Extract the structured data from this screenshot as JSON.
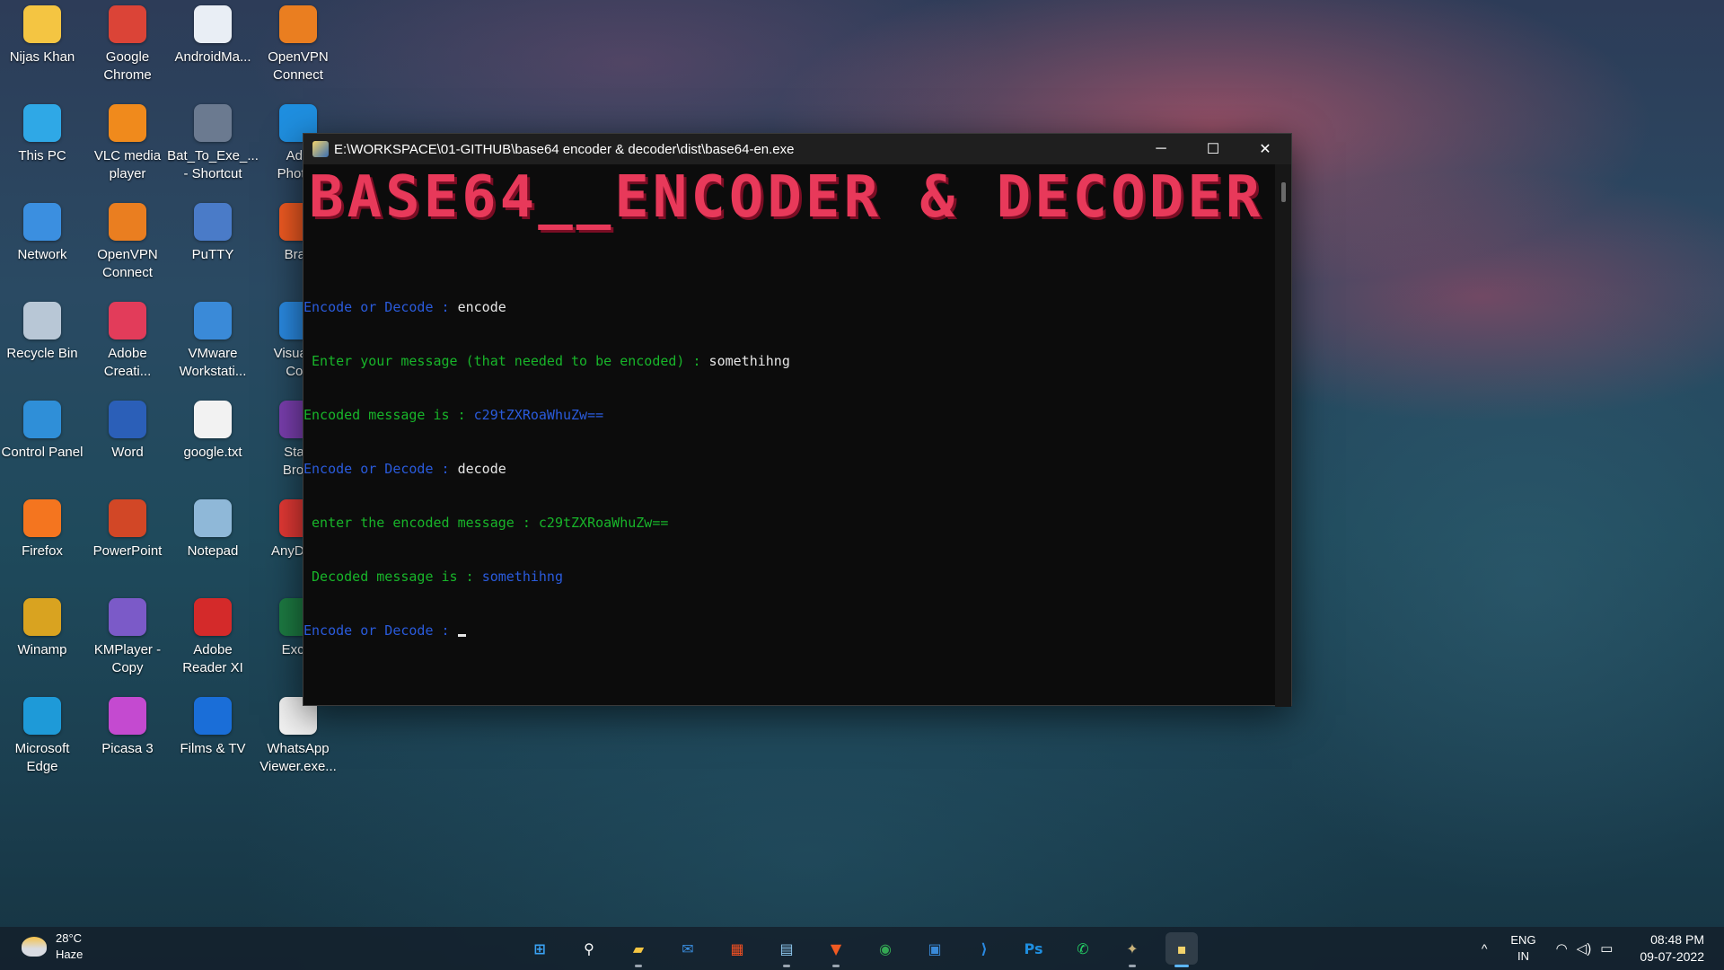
{
  "desktop": {
    "icons": [
      {
        "label": "Nijas Khan",
        "icon": "folder-icon",
        "color": "#f4c542"
      },
      {
        "label": "Google\nChrome",
        "icon": "chrome-icon",
        "color": "#db4437"
      },
      {
        "label": "AndroidMa...",
        "icon": "document-icon",
        "color": "#e9eef5"
      },
      {
        "label": "OpenVPN\nConnect",
        "icon": "openvpn-icon",
        "color": "#ea7e20"
      },
      {
        "label": "This PC",
        "icon": "monitor-icon",
        "color": "#2fa8e6"
      },
      {
        "label": "VLC media\nplayer",
        "icon": "vlc-icon",
        "color": "#f08a1c"
      },
      {
        "label": "Bat_To_Exe_...\n- Shortcut",
        "icon": "gear-icon",
        "color": "#6b7a90"
      },
      {
        "label": "Ado\nPhotos",
        "icon": "photoshop-icon",
        "color": "#1f8fe0"
      },
      {
        "label": "Network",
        "icon": "network-icon",
        "color": "#3b8fe0"
      },
      {
        "label": "OpenVPN\nConnect",
        "icon": "openvpn-icon",
        "color": "#ea7e20"
      },
      {
        "label": "PuTTY",
        "icon": "putty-icon",
        "color": "#4a7bc8"
      },
      {
        "label": "Brav",
        "icon": "brave-icon",
        "color": "#f05a22"
      },
      {
        "label": "Recycle Bin",
        "icon": "recycle-bin-icon",
        "color": "#b8c7d6"
      },
      {
        "label": "Adobe\nCreati...",
        "icon": "creative-cloud-icon",
        "color": "#e23c5a"
      },
      {
        "label": "VMware\nWorkstati...",
        "icon": "vmware-icon",
        "color": "#3a8ad8"
      },
      {
        "label": "Visual S\nCod",
        "icon": "vscode-icon",
        "color": "#2a8ae2"
      },
      {
        "label": "Control Panel",
        "icon": "control-panel-icon",
        "color": "#2f8fd8"
      },
      {
        "label": "Word",
        "icon": "word-icon",
        "color": "#2b5fb8"
      },
      {
        "label": "google.txt",
        "icon": "text-file-icon",
        "color": "#f2f2f2"
      },
      {
        "label": "Start\nBrow",
        "icon": "tor-icon",
        "color": "#7b3fb0"
      },
      {
        "label": "Firefox",
        "icon": "firefox-icon",
        "color": "#f4751f"
      },
      {
        "label": "PowerPoint",
        "icon": "powerpoint-icon",
        "color": "#d24726"
      },
      {
        "label": "Notepad",
        "icon": "notepad-icon",
        "color": "#8fb8d8"
      },
      {
        "label": "AnyDesk",
        "icon": "anydesk-icon",
        "color": "#e53935"
      },
      {
        "label": "Winamp",
        "icon": "winamp-icon",
        "color": "#d9a320"
      },
      {
        "label": "KMPlayer -\nCopy",
        "icon": "kmplayer-icon",
        "color": "#7b5ac8"
      },
      {
        "label": "Adobe\nReader XI",
        "icon": "pdf-icon",
        "color": "#d42a2a"
      },
      {
        "label": "Excel",
        "icon": "excel-icon",
        "color": "#1d7c43"
      },
      {
        "label": "Microsoft\nEdge",
        "icon": "edge-icon",
        "color": "#1e9ad8"
      },
      {
        "label": "Picasa 3",
        "icon": "picasa-icon",
        "color": "#c44ad0"
      },
      {
        "label": "Films & TV",
        "icon": "films-tv-icon",
        "color": "#1a6ed8"
      },
      {
        "label": "WhatsApp\nViewer.exe...",
        "icon": "file-icon",
        "color": "#f2f2f2"
      }
    ]
  },
  "console": {
    "title": "E:\\WORKSPACE\\01-GITHUB\\base64 encoder & decoder\\dist\\base64-en.exe",
    "minimize": "─",
    "maximize": "☐",
    "close": "✕",
    "banner": "BASE64__ENCODER & DECODER",
    "lines": [
      {
        "prompt": "Encode or Decode : ",
        "value": "encode"
      },
      {
        "prompt": " Enter your message (that needed to be encoded) : ",
        "value": "somethihng"
      },
      {
        "prompt": "Encoded message is : ",
        "value": "c29tZXRoaWhuZw=="
      },
      {
        "prompt": "Encode or Decode : ",
        "value": "decode"
      },
      {
        "prompt": " enter the encoded message : ",
        "value": "c29tZXRoaWhuZw=="
      },
      {
        "prompt": " Decoded message is : ",
        "value": "somethihng"
      },
      {
        "prompt": "Encode or Decode : ",
        "value": ""
      }
    ],
    "colors": {
      "prompt_blue": "#2a5bdc",
      "prompt_green": "#18b52a",
      "banner": "#e8395a"
    }
  },
  "taskbar": {
    "weather": {
      "temp": "28°C",
      "condition": "Haze"
    },
    "apps": [
      {
        "name": "start",
        "glyph": "⊞",
        "color": "#3aa3f5"
      },
      {
        "name": "search",
        "glyph": "⚲",
        "color": "#ffffff"
      },
      {
        "name": "file-explorer",
        "glyph": "▰",
        "color": "#f4c542"
      },
      {
        "name": "mail",
        "glyph": "✉",
        "color": "#3a8ee0"
      },
      {
        "name": "store",
        "glyph": "▦",
        "color": "#f25022"
      },
      {
        "name": "notepad",
        "glyph": "▤",
        "color": "#8fc8f0"
      },
      {
        "name": "brave",
        "glyph": "▼",
        "color": "#f05a22"
      },
      {
        "name": "chrome",
        "glyph": "◉",
        "color": "#34a853"
      },
      {
        "name": "vmware",
        "glyph": "▣",
        "color": "#3a8ad8"
      },
      {
        "name": "vscode",
        "glyph": "⟩",
        "color": "#2a8ae2"
      },
      {
        "name": "photoshop",
        "glyph": "Ps",
        "color": "#1f8fe0"
      },
      {
        "name": "whatsapp",
        "glyph": "✆",
        "color": "#25d366"
      },
      {
        "name": "pinned-app",
        "glyph": "✦",
        "color": "#c8b27a"
      },
      {
        "name": "console-app",
        "glyph": "▪",
        "color": "#f3d36b"
      }
    ],
    "tray": {
      "chevron": "^",
      "language": "ENG",
      "region": "IN",
      "wifi": "◠",
      "volume": "◁)",
      "battery": "▭",
      "time": "08:48 PM",
      "date": "09-07-2022"
    }
  }
}
